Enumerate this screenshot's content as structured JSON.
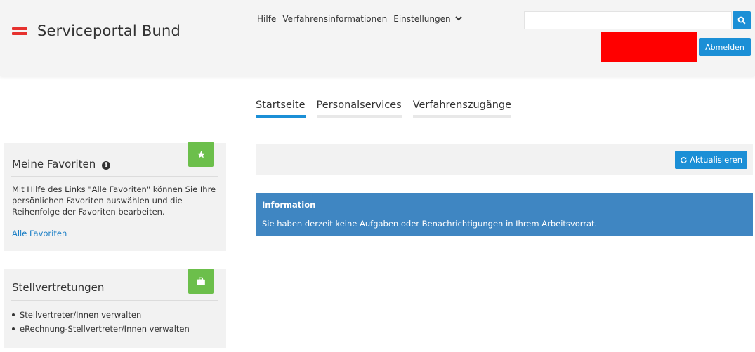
{
  "header": {
    "logo_text": "Serviceportal Bund",
    "nav": [
      "Hilfe",
      "Verfahrensinformationen",
      "Einstellungen"
    ],
    "search_placeholder": "",
    "logout_label": "Abmelden"
  },
  "tabs": [
    {
      "label": "Startseite",
      "active": true
    },
    {
      "label": "Personalservices",
      "active": false
    },
    {
      "label": "Verfahrenszugänge",
      "active": false
    }
  ],
  "favorites": {
    "title": "Meine Favoriten",
    "description": "Mit Hilfe des Links \"Alle Favoriten\" können Sie Ihre persönlichen Favoriten auswählen und die Reihenfolge der Favoriten bearbeiten.",
    "link_label": "Alle Favoriten",
    "badge_icon": "star-icon"
  },
  "delegations": {
    "title": "Stellvertretungen",
    "items": [
      "Stellvertreter/Innen verwalten",
      "eRechnung-Stellvertreter/Innen verwalten"
    ],
    "badge_icon": "briefcase-icon"
  },
  "main": {
    "refresh_label": "Aktualisieren",
    "info_title": "Information",
    "info_text": "Sie haben derzeit keine Aufgaben oder Benachrichtigungen in Ihrem Arbeitsvorrat."
  },
  "colors": {
    "accent": "#1b8fd6",
    "info_panel": "#3f86c2",
    "badge_green": "#6cbf4b",
    "flag_red": "#e6312e",
    "redacted": "#ff0000"
  }
}
